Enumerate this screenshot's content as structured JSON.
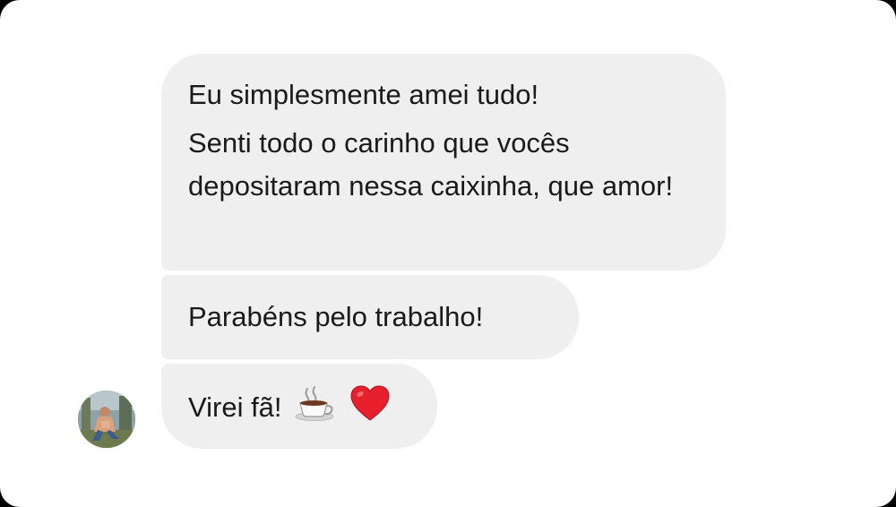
{
  "conversation": {
    "messages": [
      {
        "lines": [
          "Eu simplesmente amei tudo!",
          "Senti todo o carinho que vocês depositaram nessa caixinha, que amor!"
        ]
      },
      {
        "text": "Parabéns pelo trabalho!"
      },
      {
        "text": "Virei fã!",
        "emojis": [
          "coffee-cup-icon",
          "red-heart-icon"
        ]
      }
    ],
    "sender": {
      "avatar_icon": "user-avatar"
    }
  },
  "colors": {
    "bubble": "#efefef",
    "text": "#1a1a1a",
    "background": "#ffffff",
    "heart": "#e8202e"
  }
}
